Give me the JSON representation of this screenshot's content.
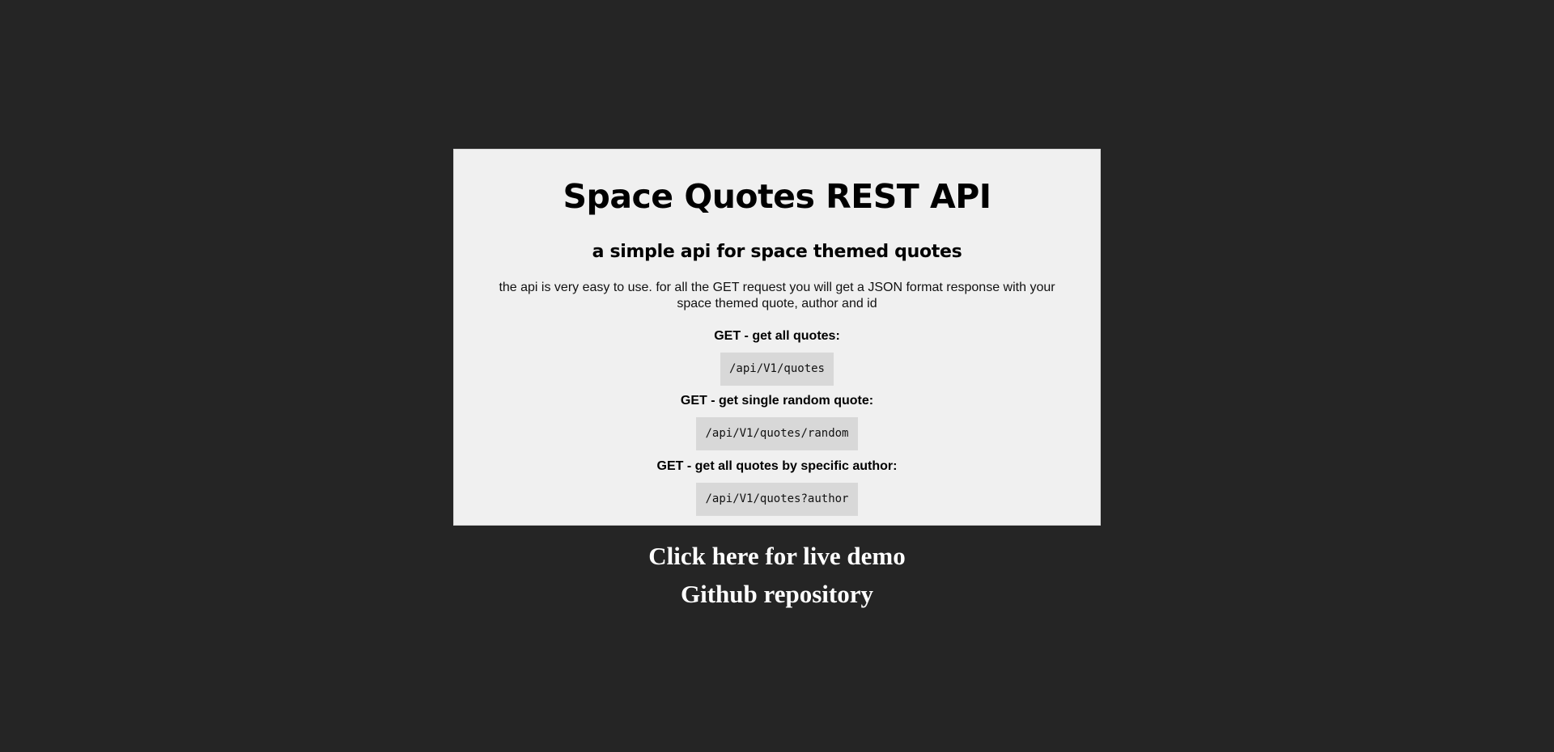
{
  "card": {
    "title": "Space Quotes REST API",
    "subtitle": "a simple api for space themed quotes",
    "description": "the api is very easy to use. for all the GET request you will get a JSON format response with your space themed quote, author and id"
  },
  "endpoints": [
    {
      "label": "GET - get all quotes:",
      "path": "/api/V1/quotes"
    },
    {
      "label": "GET - get single random quote:",
      "path": "/api/V1/quotes/random"
    },
    {
      "label": "GET - get all quotes by specific author:",
      "path": "/api/V1/quotes?author"
    }
  ],
  "links": {
    "demo_label": "Click here for live demo",
    "github_label": "Github repository"
  },
  "colors": {
    "page_background": "#252525",
    "card_background": "#f0f0f0",
    "code_background": "#d8d8d8",
    "link_text": "#ffffff"
  }
}
